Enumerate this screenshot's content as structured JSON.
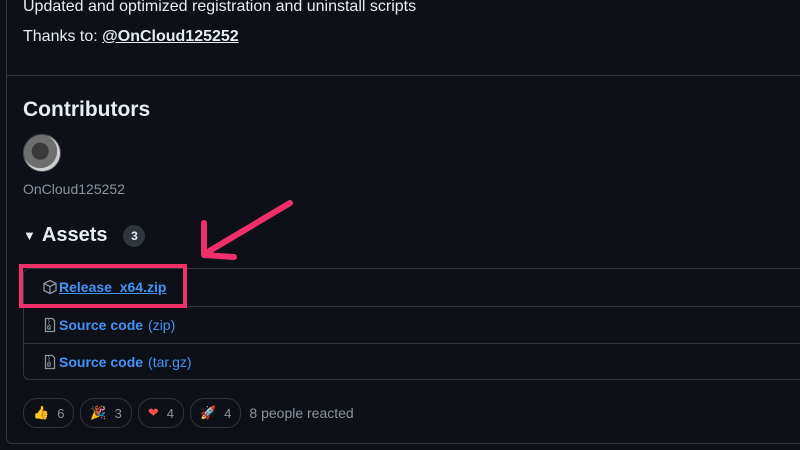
{
  "notes": {
    "line1": "Updated and optimized registration and uninstall scripts",
    "thanks_prefix": "Thanks to: ",
    "mention": "@OnCloud125252"
  },
  "contributors": {
    "title": "Contributors",
    "name": "OnCloud125252"
  },
  "assets": {
    "title": "Assets",
    "count": "3",
    "items": [
      {
        "label": "Release_x64.zip",
        "ext": "",
        "icon": "package-icon"
      },
      {
        "label": "Source code",
        "ext": "(zip)",
        "icon": "file-zip-icon"
      },
      {
        "label": "Source code",
        "ext": "(tar.gz)",
        "icon": "file-zip-icon"
      }
    ]
  },
  "reactions": {
    "items": [
      {
        "emoji": "👍",
        "count": "6"
      },
      {
        "emoji": "🎉",
        "count": "3"
      },
      {
        "emoji": "❤",
        "count": "4"
      },
      {
        "emoji": "🚀",
        "count": "4"
      }
    ],
    "summary": "8 people reacted"
  },
  "annotation": {
    "color": "#f0306a"
  }
}
